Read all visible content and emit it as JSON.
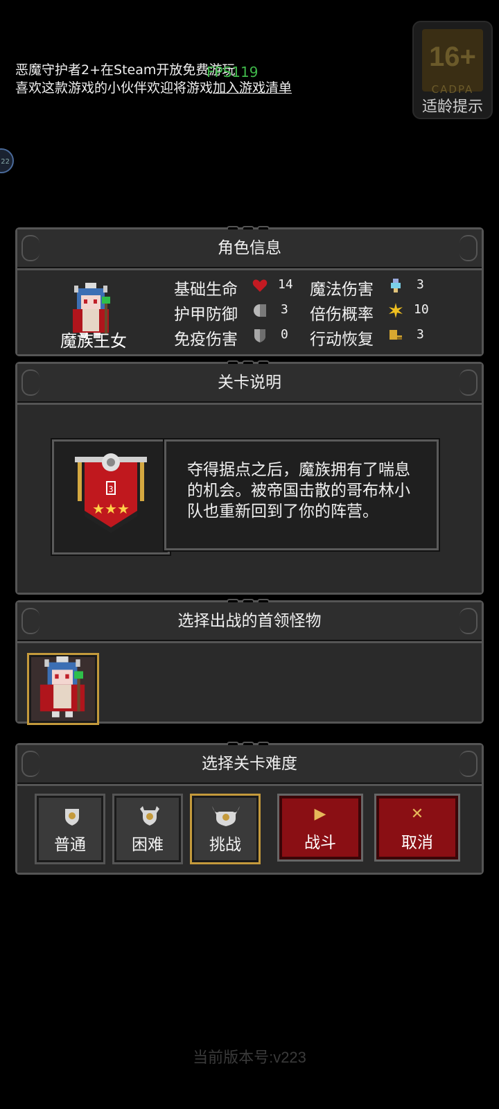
{
  "notice": {
    "line1": "恶魔守护者2+在Steam开放免费游玩",
    "line2_prefix": "喜欢这款游戏的小伙伴欢迎将游戏",
    "line2_link": "加入游戏清单"
  },
  "fps": "FPS119",
  "age_rating": {
    "age": "16+",
    "org": "CADPA",
    "hint": "适龄提示"
  },
  "side_bubble": "22",
  "character_panel": {
    "title": "角色信息",
    "name": "魔族王女",
    "stats": [
      {
        "label": "基础生命",
        "icon": "heart-icon",
        "value": "14"
      },
      {
        "label": "魔法伤害",
        "icon": "potion-icon",
        "value": "3"
      },
      {
        "label": "护甲防御",
        "icon": "armor-icon",
        "value": "3"
      },
      {
        "label": "倍伤概率",
        "icon": "spark-icon",
        "value": "10"
      },
      {
        "label": "免疫伤害",
        "icon": "shield-icon",
        "value": "0"
      },
      {
        "label": "行动恢复",
        "icon": "boot-icon",
        "value": "3"
      }
    ]
  },
  "stage_panel": {
    "title": "关卡说明",
    "stage_number": "3",
    "stars": "★★★",
    "description": "夺得据点之后，魔族拥有了喘息的机会。被帝国击散的哥布林小队也重新回到了你的阵营。"
  },
  "boss_panel": {
    "title": "选择出战的首领怪物"
  },
  "difficulty_panel": {
    "title": "选择关卡难度",
    "options": [
      "普通",
      "困难",
      "挑战"
    ],
    "selected": "挑战",
    "fight_label": "战斗",
    "cancel_label": "取消",
    "fight_glyph": "▶",
    "cancel_glyph": "✕"
  },
  "version": "当前版本号:v223",
  "colors": {
    "gold": "#c49a3c",
    "red_button": "#8a0f14",
    "banner_red": "#c0181e"
  }
}
